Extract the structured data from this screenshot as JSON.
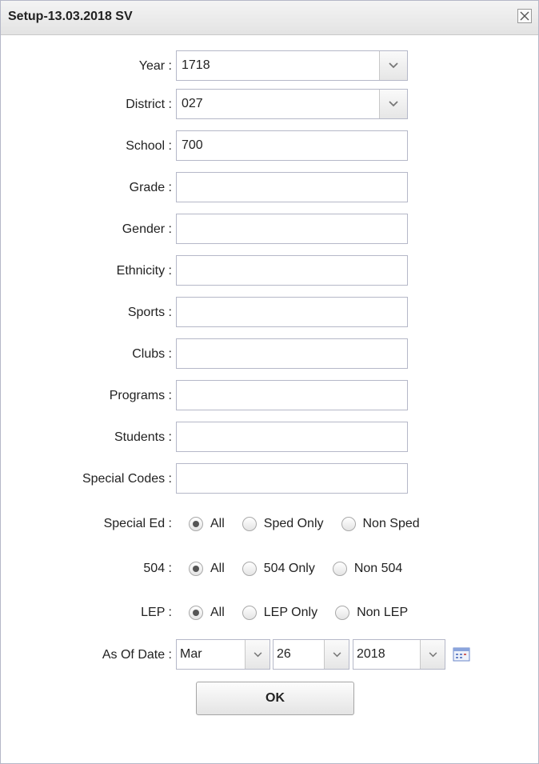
{
  "window": {
    "title": "Setup-13.03.2018 SV"
  },
  "fields": {
    "year": {
      "label": "Year :",
      "value": "1718"
    },
    "district": {
      "label": "District :",
      "value": "027"
    },
    "school": {
      "label": "School :",
      "value": "700"
    },
    "grade": {
      "label": "Grade :",
      "value": ""
    },
    "gender": {
      "label": "Gender :",
      "value": ""
    },
    "ethnicity": {
      "label": "Ethnicity :",
      "value": ""
    },
    "sports": {
      "label": "Sports :",
      "value": ""
    },
    "clubs": {
      "label": "Clubs :",
      "value": ""
    },
    "programs": {
      "label": "Programs :",
      "value": ""
    },
    "students": {
      "label": "Students :",
      "value": ""
    },
    "special_codes": {
      "label": "Special Codes :",
      "value": ""
    }
  },
  "radios": {
    "special_ed": {
      "label": "Special Ed :",
      "options": [
        "All",
        "Sped Only",
        "Non Sped"
      ],
      "selected": "All"
    },
    "s504": {
      "label": "504 :",
      "options": [
        "All",
        "504 Only",
        "Non 504"
      ],
      "selected": "All"
    },
    "lep": {
      "label": "LEP :",
      "options": [
        "All",
        "LEP Only",
        "Non LEP"
      ],
      "selected": "All"
    }
  },
  "as_of_date": {
    "label": "As Of Date :",
    "month": "Mar",
    "day": "26",
    "year": "2018"
  },
  "ok_label": "OK",
  "icons": {
    "close": "close-icon",
    "dropdown": "chevron-down-icon",
    "calendar": "calendar-icon"
  },
  "colors": {
    "border": "#b5b8c8",
    "titlebar": "#e8e8e8",
    "calendar": "#6a86c8"
  }
}
